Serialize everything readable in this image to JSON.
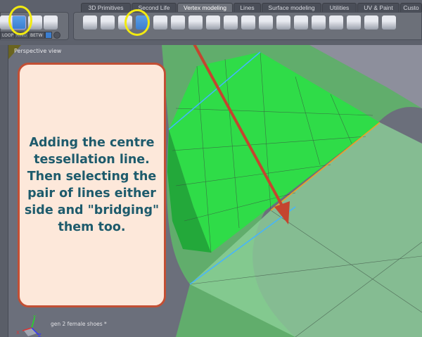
{
  "tabs": [
    {
      "label": "3D Primitives"
    },
    {
      "label": "Second Life"
    },
    {
      "label": "Vertex modeling",
      "active": true
    },
    {
      "label": "Lines"
    },
    {
      "label": "Surface modeling"
    },
    {
      "label": "Utilities"
    },
    {
      "label": "UV & Paint"
    },
    {
      "label": "Custo"
    }
  ],
  "selection_buttons": {
    "loop": "LOOP",
    "ring": "RING",
    "between": "BETW"
  },
  "viewport": {
    "label": "Perspective view",
    "object_name": "gen 2 female shoes *",
    "axes": {
      "x": "X",
      "y": "Y",
      "z": "Z"
    }
  },
  "note": {
    "text": "Adding the centre tessellation line. Then selecting the pair of lines either side and \"bridging\" them too."
  },
  "colors": {
    "highlight_ring": "#f2ea10",
    "arrow": "#c4452f",
    "note_border": "#c24f34",
    "note_fill": "#fde8da",
    "note_text": "#1e5b6c",
    "mesh_green": "#33e04a"
  }
}
